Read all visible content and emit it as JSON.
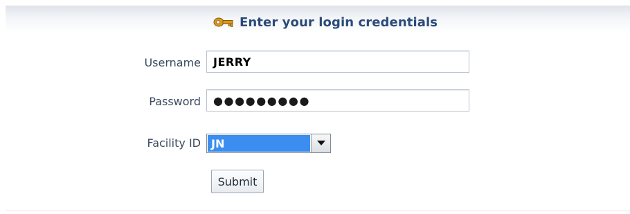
{
  "header": {
    "title": "Enter your login credentials",
    "icon": "key-icon"
  },
  "form": {
    "username": {
      "label": "Username",
      "value": "JERRY"
    },
    "password": {
      "label": "Password",
      "masked_value": "●●●●●●●●●"
    },
    "facility": {
      "label": "Facility ID",
      "selected": "JN"
    },
    "submit_label": "Submit"
  },
  "colors": {
    "title": "#2b4a78",
    "label": "#3a4a5e",
    "select_highlight": "#3b8ef0",
    "key_gold": "#d69a22"
  }
}
